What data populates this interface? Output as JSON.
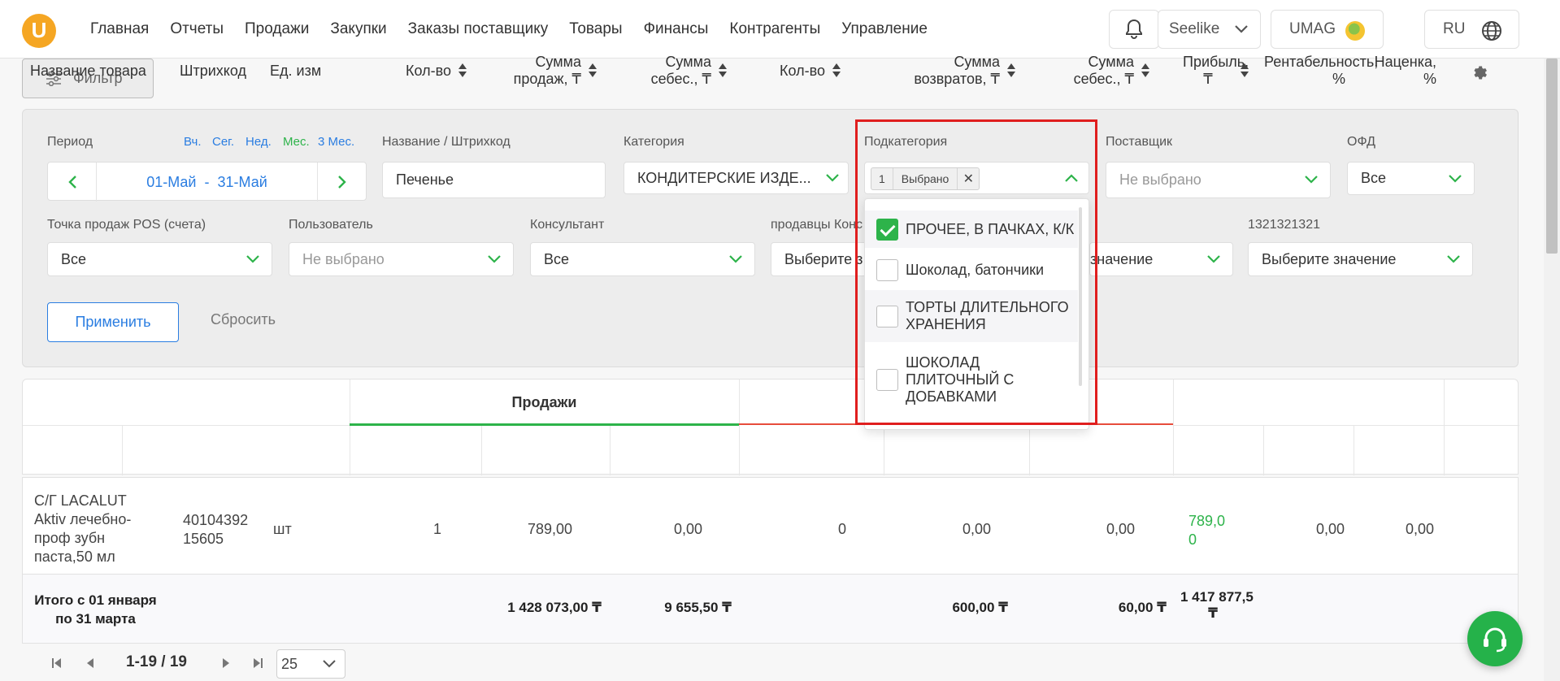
{
  "nav": {
    "logo": "U",
    "items": [
      "Главная",
      "Отчеты",
      "Продажи",
      "Закупки",
      "Заказы поставщику",
      "Товары",
      "Финансы",
      "Контрагенты",
      "Управление"
    ],
    "store": "Seelike",
    "account": "UMAG",
    "lang": "RU"
  },
  "filter": {
    "button": "Фильтр",
    "period_label": "Период",
    "quick": [
      "Вч.",
      "Сег.",
      "Нед.",
      "Мес.",
      "3 Мес."
    ],
    "date_from": "01-Май",
    "date_sep": "-",
    "date_to": "31-Май",
    "name_label": "Название / Штрихкод",
    "name_value": "Печенье",
    "category_label": "Категория",
    "category_value": "КОНДИТЕРСКИЕ ИЗДЕ...",
    "subcategory_label": "Подкатегория",
    "sub_tag_count": "1",
    "sub_tag_text": "Выбрано",
    "supplier_label": "Поставщик",
    "supplier_placeholder": "Не выбрано",
    "ofd_label": "ОФД",
    "ofd_value": "Все",
    "pos_label": "Точка продаж POS (счета)",
    "pos_value": "Все",
    "user_label": "Пользователь",
    "user_placeholder": "Не выбрано",
    "consultant_label": "Консультант",
    "consultant_value": "Все",
    "sellers_label": "продавцы Конс",
    "sellers_value": "Выберите з",
    "hidden_value": "значение",
    "custom_label": "1321321321",
    "custom_value": "Выберите значение",
    "apply": "Применить",
    "reset": "Сбросить"
  },
  "dropdown": {
    "options": [
      {
        "label": "ПРОЧЕЕ, В ПАЧКАХ, К/К",
        "checked": true
      },
      {
        "label": "Шоколад, батончики",
        "checked": false
      },
      {
        "label": "ТОРТЫ ДЛИТЕЛЬНОГО ХРАНЕНИЯ",
        "checked": false
      },
      {
        "label": "ШОКОЛАД ПЛИТОЧНЫЙ С ДОБАВКАМИ",
        "checked": false
      }
    ],
    "highlight_color": "#e01e1e",
    "check_color": "#2db34a"
  },
  "table": {
    "group_sales": "Продажи",
    "headers": {
      "name": "Название товара",
      "barcode": "Штрихкод",
      "unit": "Ед. изм",
      "qty": "Кол-во",
      "sales_sum": "Сумма продаж, ₸",
      "cost_sum": "Сумма себес., ₸",
      "ret_qty": "Кол-во",
      "ret_sum": "Сумма возвратов, ₸",
      "ret_cost": "Сумма себес., ₸",
      "profit": "Прибыль, ₸",
      "profitability": "Рентабельность, %",
      "markup": "Наценка, %"
    },
    "row": {
      "name": "С/Г LACALUT Aktiv лечебно-проф зубн паста,50 мл",
      "barcode": "4010439215605",
      "unit": "шт",
      "qty": "1",
      "sales_sum": "789,00",
      "cost_sum": "0,00",
      "ret_qty": "0",
      "ret_sum": "0,00",
      "ret_cost": "0,00",
      "profit": "789,00",
      "profitability": "0,00",
      "markup": "0,00"
    },
    "total": {
      "label": "Итого с 01 января по 31 марта",
      "sales_sum": "1 428 073,00 ₸",
      "cost_sum": "9 655,50 ₸",
      "ret_sum": "600,00 ₸",
      "ret_cost": "60,00 ₸",
      "profit": "1 417 877,5",
      "profit_unit": "₸"
    }
  },
  "pager": {
    "range": "1-19 / 19",
    "page_size": "25"
  },
  "colors": {
    "accent": "#2a7de1",
    "green": "#2db34a",
    "logo": "#f5a623",
    "sales_line": "#2db34a",
    "returns_line": "#e74c3c"
  }
}
